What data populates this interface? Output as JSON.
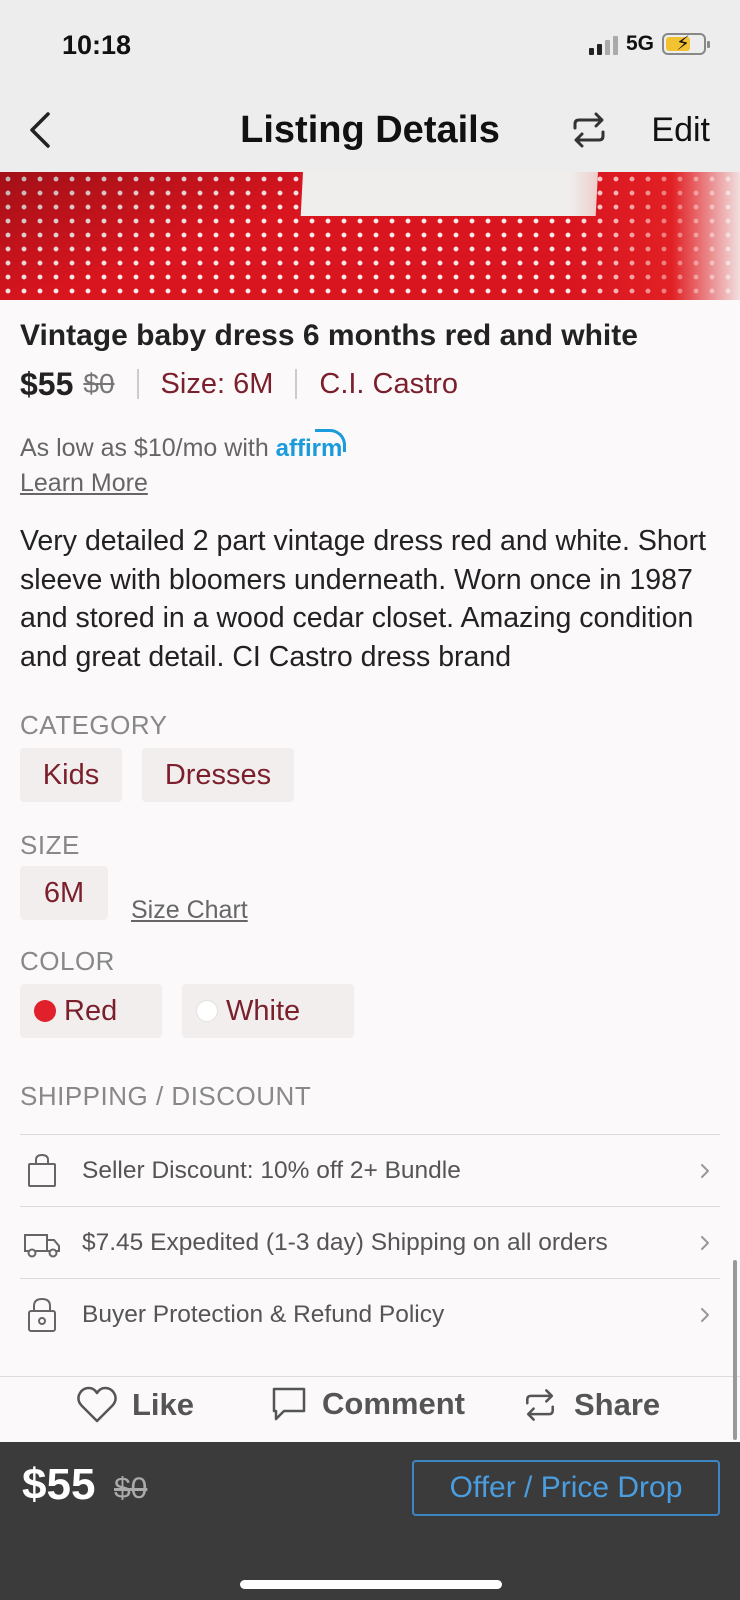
{
  "status_bar": {
    "time": "10:18",
    "network": "5G",
    "signal_bars_active": 2,
    "signal_bars_total": 4,
    "battery_level": 0.55,
    "battery_charging": true
  },
  "nav": {
    "title": "Listing Details",
    "edit_label": "Edit"
  },
  "product": {
    "title": "Vintage baby dress 6 months red and white",
    "price": "$55",
    "original_price": "$0",
    "size_label": "Size: 6M",
    "brand": "C.I. Castro",
    "affirm_text": "As low as $10/mo with",
    "affirm_logo": "affirm",
    "learn_more": "Learn More",
    "description": "Very detailed 2 part vintage dress red and white. Short sleeve with bloomers underneath. Worn once in 1987 and stored in a wood cedar closet. Amazing condition and great detail. CI Castro dress brand"
  },
  "category": {
    "label": "CATEGORY",
    "chips": [
      "Kids",
      "Dresses"
    ]
  },
  "size": {
    "label": "SIZE",
    "value": "6M",
    "chart_link": "Size Chart"
  },
  "color": {
    "label": "COLOR",
    "options": [
      {
        "name": "Red",
        "swatch": "#e0202a"
      },
      {
        "name": "White",
        "swatch": "#ffffff"
      }
    ]
  },
  "shipping": {
    "label": "SHIPPING / DISCOUNT",
    "rows": [
      {
        "icon": "shopping-bag-icon",
        "text": "Seller Discount: 10% off 2+ Bundle"
      },
      {
        "icon": "truck-icon",
        "text": "$7.45 Expedited (1-3 day) Shipping on all orders"
      },
      {
        "icon": "lock-icon",
        "text": "Buyer Protection & Refund Policy"
      }
    ]
  },
  "actions": {
    "like": "Like",
    "comment": "Comment",
    "share": "Share"
  },
  "bottom_bar": {
    "price": "$55",
    "original_price": "$0",
    "offer_button": "Offer / Price Drop"
  },
  "colors": {
    "accent": "#7a1f2b",
    "affirm_blue": "#1a9bdb",
    "offer_blue": "#4a9ee0",
    "bottom_bar_bg": "#3b3b3b"
  }
}
